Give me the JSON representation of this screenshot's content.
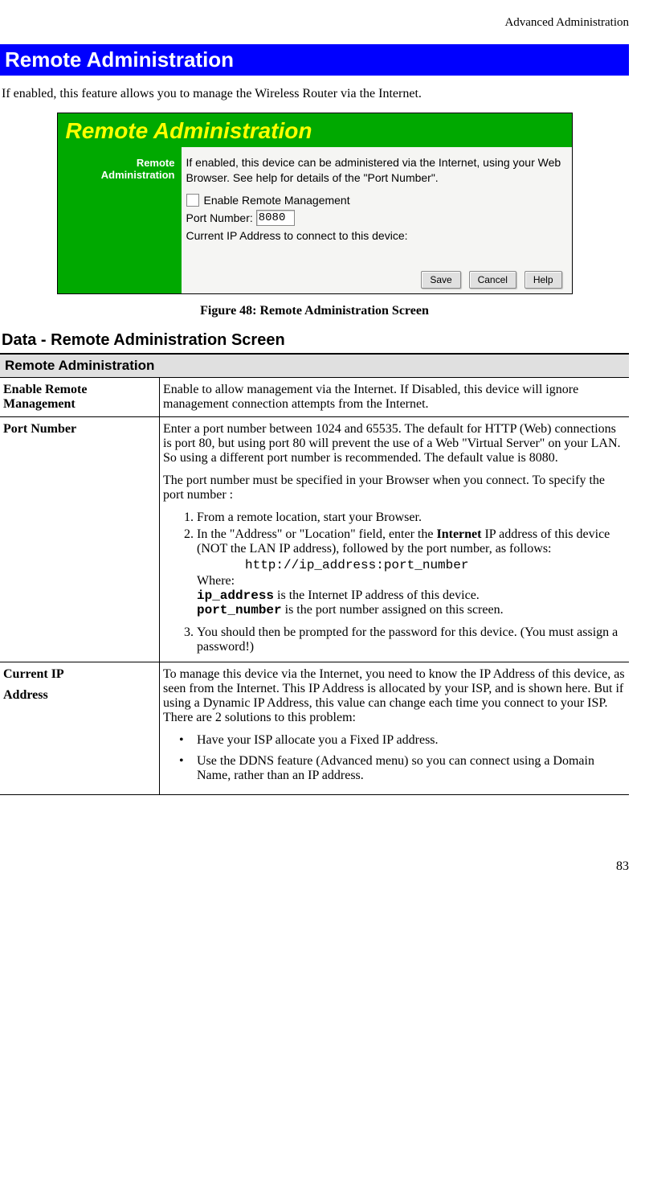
{
  "header": "Advanced Administration",
  "mainHeading": "Remote Administration",
  "introText": "If enabled, this feature allows you to manage the Wireless Router via the Internet.",
  "screenshot": {
    "title": "Remote Administration",
    "sidebar": "Remote Administration",
    "desc": "If enabled, this device can be administered via the Internet, using your Web Browser. See help for details of the \"Port Number\".",
    "checkboxLabel": "Enable Remote Management",
    "portLabel": "Port Number:",
    "portValue": "8080",
    "ipLabel": "Current IP Address to connect to this device:",
    "buttons": {
      "save": "Save",
      "cancel": "Cancel",
      "help": "Help"
    }
  },
  "figureCaption": "Figure 48: Remote Administration Screen",
  "dataHeading": "Data - Remote Administration Screen",
  "tableHeader": "Remote Administration",
  "rows": {
    "enable": {
      "label": "Enable Remote Management",
      "desc": "Enable to allow management via the Internet. If Disabled, this device will ignore management connection attempts from the Internet."
    },
    "portNumber": {
      "label": "Port Number",
      "p1": "Enter a port number between 1024 and 65535. The default for HTTP (Web) connections is port 80, but using port 80 will prevent the use of a Web \"Virtual Server\" on your LAN. So using a different port number is recommended. The default value is 8080.",
      "p2": "The port number must be specified in your Browser when you connect. To specify the port number :",
      "li1": "From a remote location, start your Browser.",
      "li2a": "In the \"Address\" or \"Location\" field, enter the ",
      "li2bold": "Internet",
      "li2b": " IP address of this device (NOT the LAN IP address), followed by the port number, as follows:",
      "code": "http://ip_address:port_number",
      "where": "Where:",
      "ipCode": "ip_address",
      "ipDesc": " is the Internet IP address of this device.",
      "portCode": "port_number",
      "portDesc": " is the port number assigned on this screen.",
      "li3": "You should then be prompted for the password for this device. (You must assign a password!)"
    },
    "currentIp": {
      "label1": "Current IP",
      "label2": "Address",
      "p1": "To manage this device via the Internet, you need to know the IP Address of this device, as seen from the Internet. This IP Address is allocated by your ISP, and is shown here. But if using a Dynamic IP Address, this value can change each time you connect to your ISP. There are 2 solutions to this problem:",
      "b1": "Have your ISP allocate you a Fixed IP address.",
      "b2": "Use the DDNS feature (Advanced menu) so you can connect using a Domain Name, rather than an IP address."
    }
  },
  "pageNumber": "83"
}
